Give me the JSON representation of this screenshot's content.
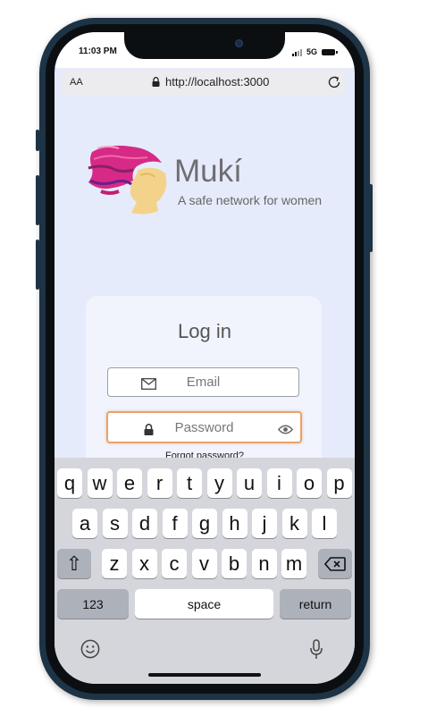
{
  "status_bar": {
    "time": "11:03 PM",
    "network": "5G"
  },
  "browser": {
    "text_size_label": "AA",
    "url": "http://localhost:3000"
  },
  "brand": {
    "name": "Mukí",
    "tagline": "A safe network for women"
  },
  "login": {
    "title": "Log in",
    "email_placeholder": "Email",
    "password_placeholder": "Password",
    "forgot_password": "Forgot password?"
  },
  "keyboard": {
    "row1": [
      "q",
      "w",
      "e",
      "r",
      "t",
      "y",
      "u",
      "i",
      "o",
      "p"
    ],
    "row2": [
      "a",
      "s",
      "d",
      "f",
      "g",
      "h",
      "j",
      "k",
      "l"
    ],
    "row3": [
      "z",
      "x",
      "c",
      "v",
      "b",
      "n",
      "m"
    ],
    "shift_glyph": "⇧",
    "numbers_label": "123",
    "space_label": "space",
    "return_label": "return"
  },
  "colors": {
    "screen_bg": "#e6ebfb",
    "card_bg": "#f1f4fd",
    "focus_border": "#e9a16a",
    "phone_frame": "#1d3346",
    "keyboard_bg": "#d5d6dc"
  }
}
